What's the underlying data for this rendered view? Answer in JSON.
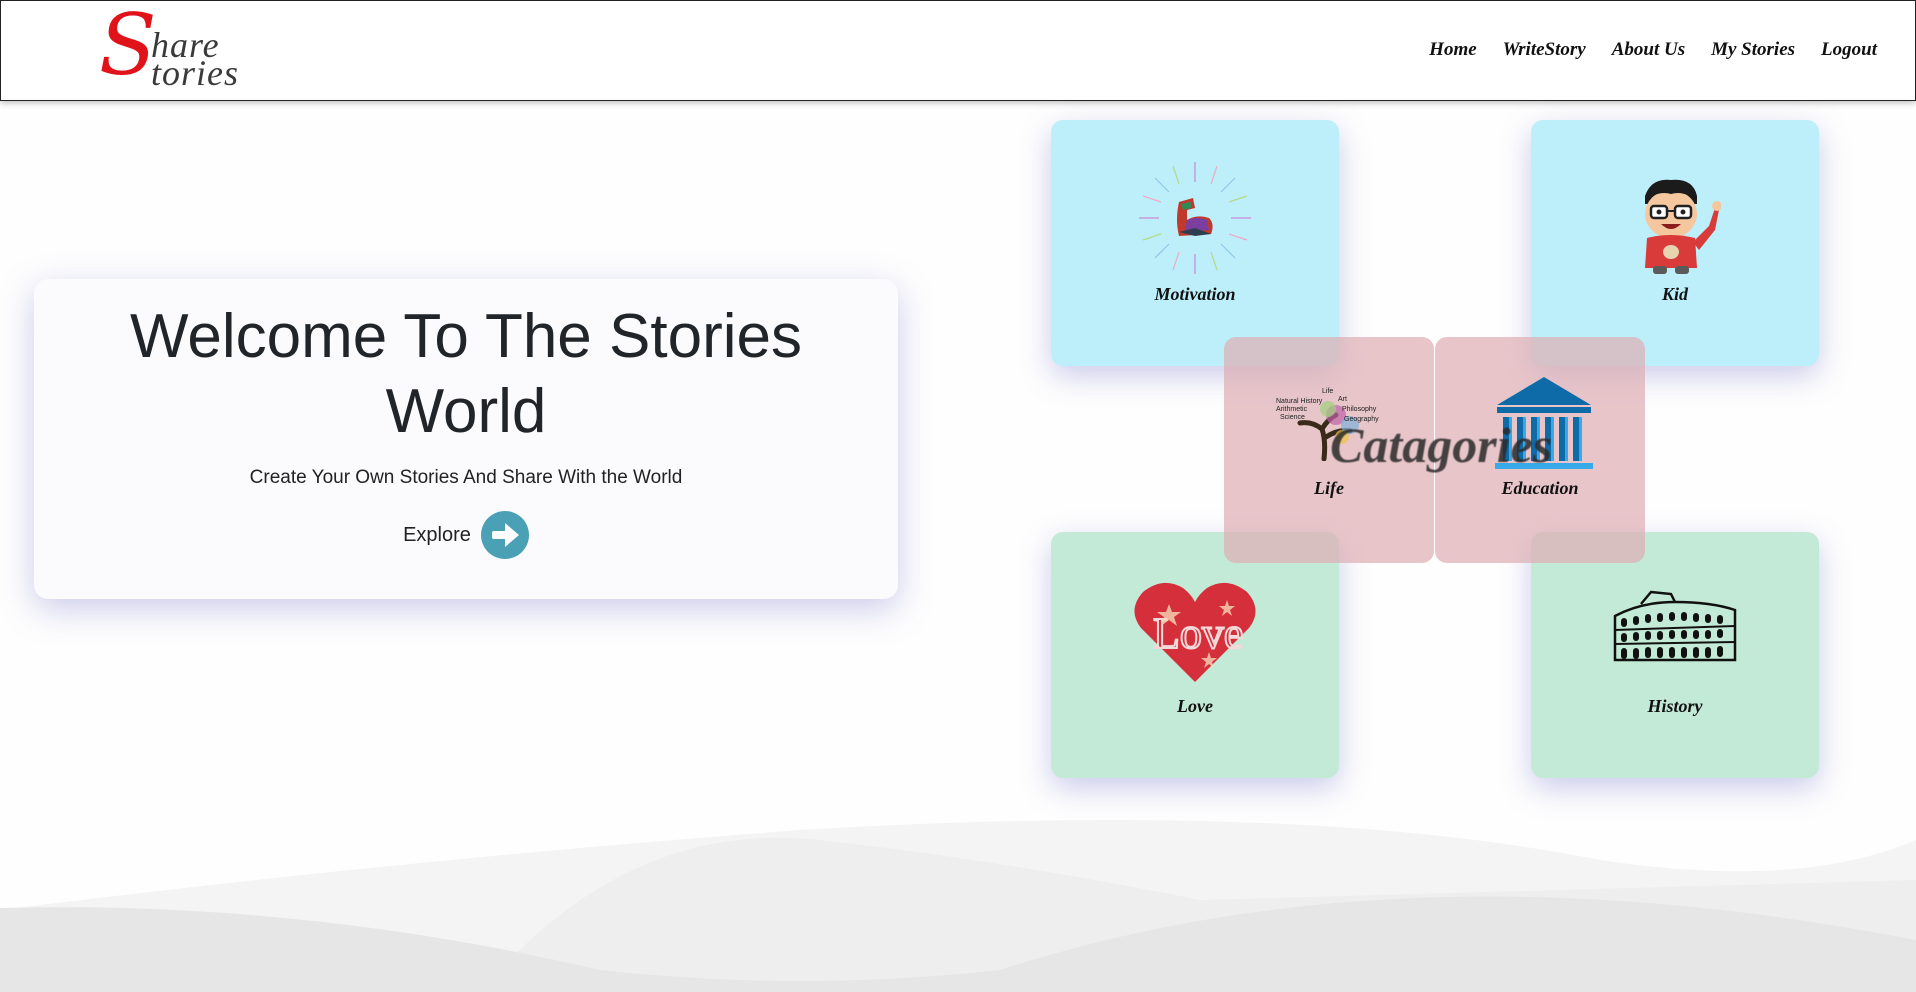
{
  "logo": {
    "s": "S",
    "line1": "hare",
    "line2": "tories"
  },
  "nav": [
    "Home",
    "WriteStory",
    "About Us",
    "My Stories",
    "Logout"
  ],
  "hero": {
    "title": "Welcome To The Stories World",
    "subtitle": "Create Your Own Stories And Share With the World",
    "explore": "Explore"
  },
  "categories": {
    "overlay_label": "Catagories",
    "motivation": "Motivation",
    "kid": "Kid",
    "life": "Life",
    "education": "Education",
    "love": "Love",
    "history": "History",
    "love_icon_text": "Love",
    "life_icon_words": [
      "Life",
      "Natural History",
      "Art",
      "Arithmetic",
      "Philosophy",
      "Science",
      "Geography"
    ]
  },
  "colors": {
    "logo_red": "#e0121a",
    "card_blue": "#bdeffb",
    "card_green": "#c3ead6",
    "card_pink": "#deafb4",
    "explore_button": "#4aa0b5",
    "education_icon": "#0f6aa8"
  },
  "icons": {
    "explore": "arrow-right-icon",
    "motivation": "flexed-arm-icon",
    "kid": "cartoon-kid-icon",
    "life": "tree-of-knowledge-icon",
    "education": "institution-building-icon",
    "love": "heart-icon",
    "history": "colosseum-icon"
  }
}
